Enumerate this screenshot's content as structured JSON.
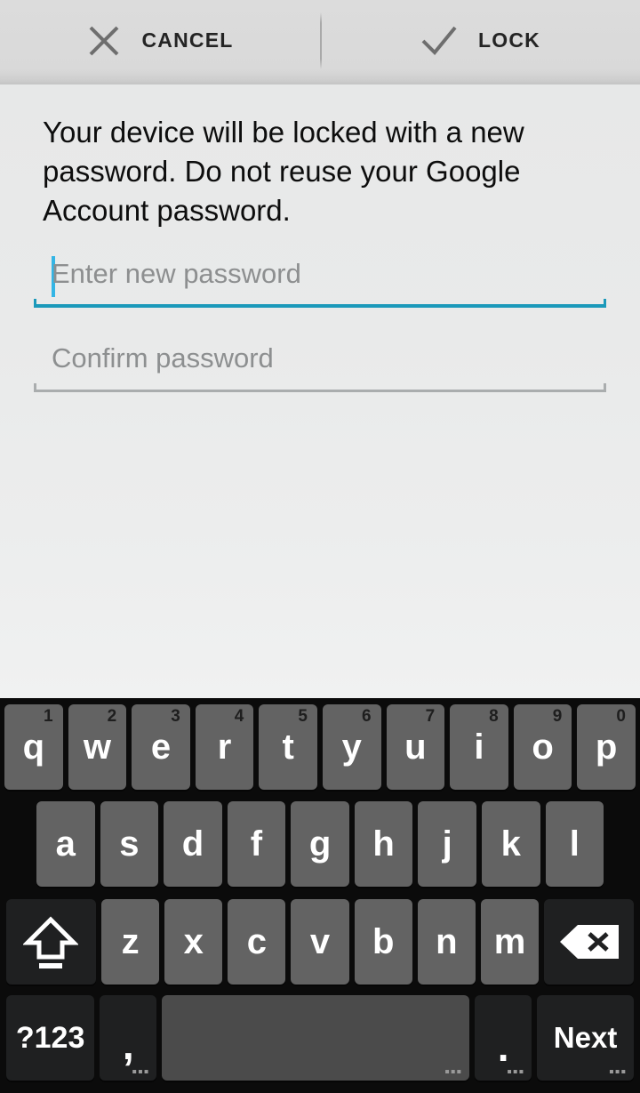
{
  "actionbar": {
    "cancel": {
      "label": "CANCEL",
      "icon": "close-icon"
    },
    "lock": {
      "label": "LOCK",
      "icon": "check-icon"
    }
  },
  "content": {
    "description": "Your device will be locked with a new password. Do not reuse your Google Account password.",
    "fields": [
      {
        "placeholder": "Enter new password",
        "value": "",
        "focused": true,
        "accent": "#1b99ba"
      },
      {
        "placeholder": "Confirm password",
        "value": "",
        "focused": false,
        "accent": "#aaadae"
      }
    ]
  },
  "keyboard": {
    "row1": [
      {
        "label": "q",
        "sup": "1"
      },
      {
        "label": "w",
        "sup": "2"
      },
      {
        "label": "e",
        "sup": "3"
      },
      {
        "label": "r",
        "sup": "4"
      },
      {
        "label": "t",
        "sup": "5"
      },
      {
        "label": "y",
        "sup": "6"
      },
      {
        "label": "u",
        "sup": "7"
      },
      {
        "label": "i",
        "sup": "8"
      },
      {
        "label": "o",
        "sup": "9"
      },
      {
        "label": "p",
        "sup": "0"
      }
    ],
    "row2": [
      {
        "label": "a"
      },
      {
        "label": "s"
      },
      {
        "label": "d"
      },
      {
        "label": "f"
      },
      {
        "label": "g"
      },
      {
        "label": "h"
      },
      {
        "label": "j"
      },
      {
        "label": "k"
      },
      {
        "label": "l"
      }
    ],
    "row3": {
      "shift": {
        "label": "",
        "icon": "shift-icon"
      },
      "letters": [
        {
          "label": "z"
        },
        {
          "label": "x"
        },
        {
          "label": "c"
        },
        {
          "label": "v"
        },
        {
          "label": "b"
        },
        {
          "label": "n"
        },
        {
          "label": "m"
        }
      ],
      "backspace": {
        "label": "",
        "icon": "backspace-icon"
      }
    },
    "row4": {
      "mode": {
        "label": "?123"
      },
      "comma": {
        "label": ",",
        "hint": "▪▪▪"
      },
      "space": {
        "label": "",
        "hint": "▪▪▪"
      },
      "period": {
        "label": ".",
        "hint": "▪▪▪"
      },
      "enter": {
        "label": "Next",
        "hint": "▪▪▪"
      }
    }
  },
  "colors": {
    "accent": "#33b5e5",
    "key_bg": "#636363",
    "key_dark_bg": "#1f2021",
    "keyboard_bg": "#0b0b0b"
  }
}
